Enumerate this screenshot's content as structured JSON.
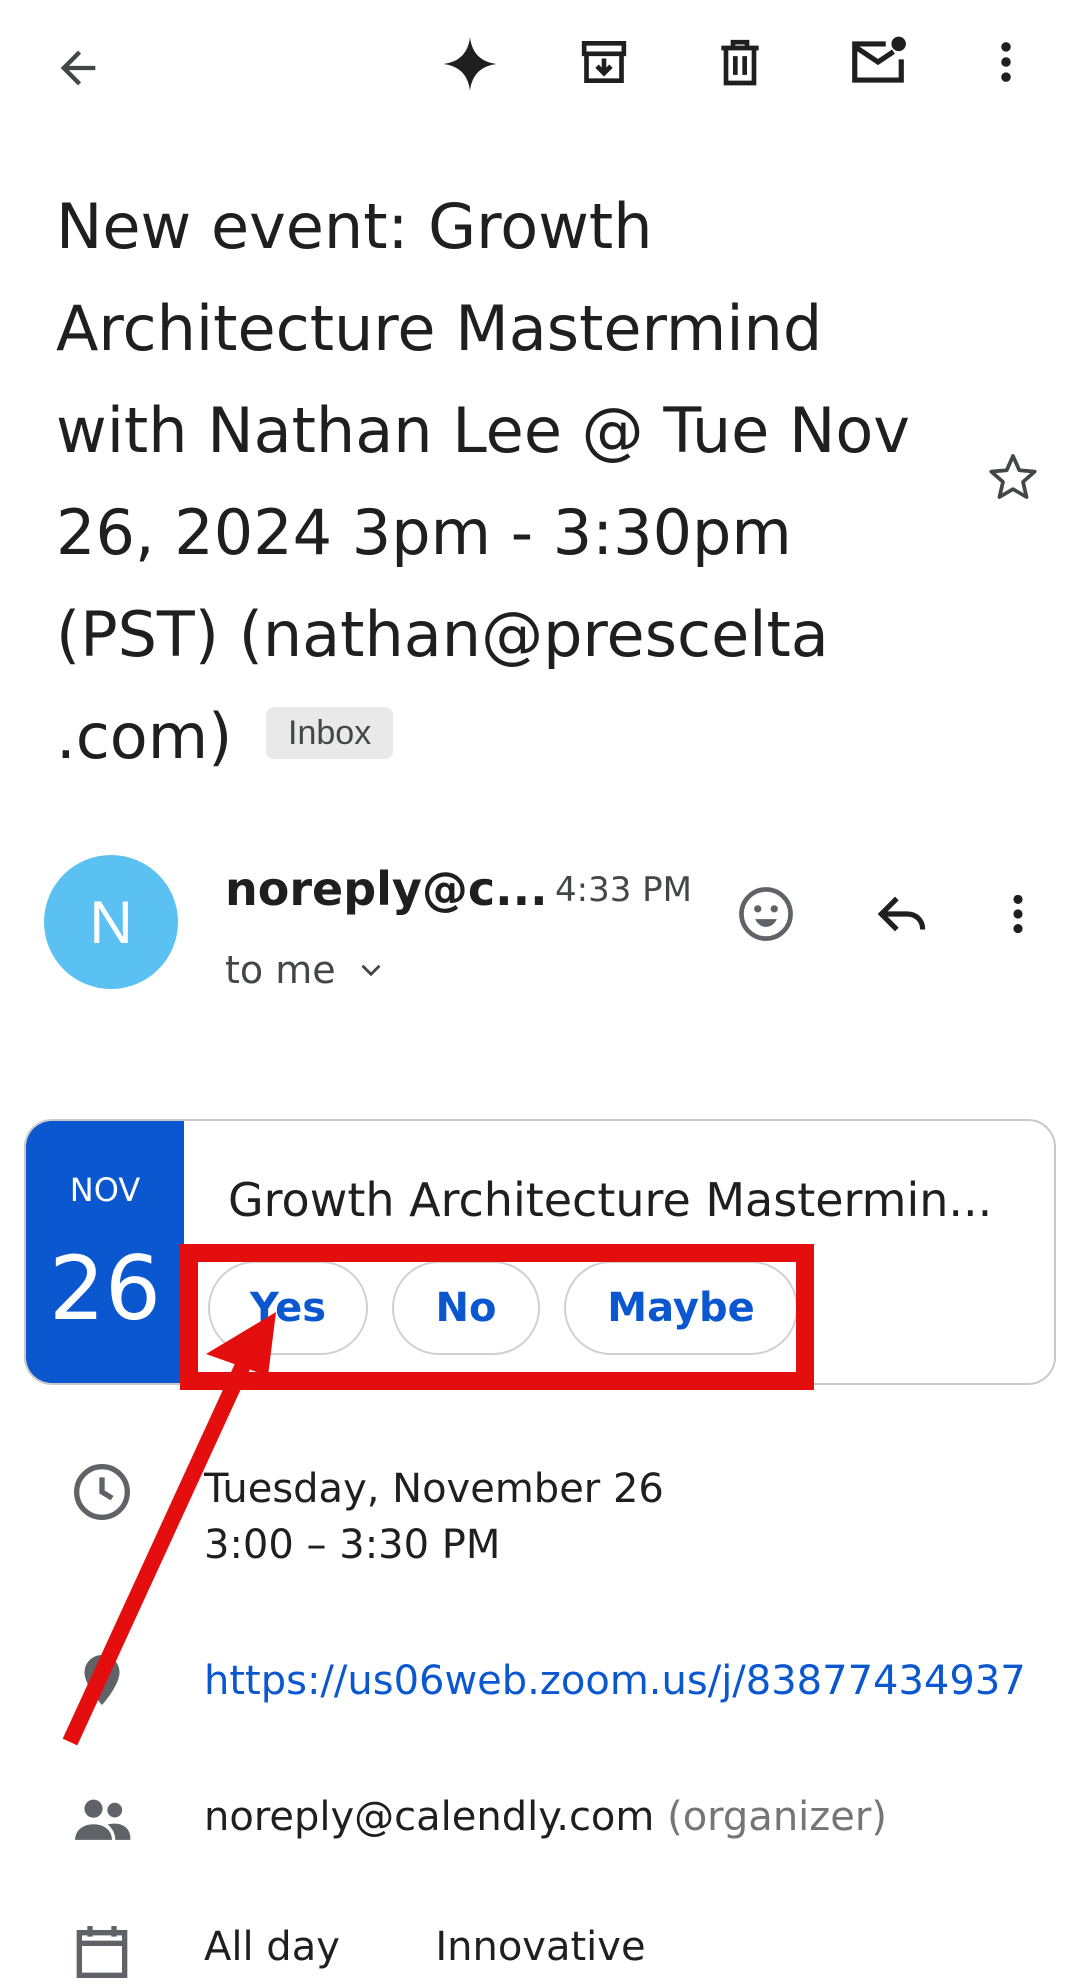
{
  "toolbar": {
    "back": "back",
    "gemini": "gemini-sparkle",
    "archive": "archive",
    "delete": "delete",
    "mark_unread": "mark-unread",
    "more": "more"
  },
  "subject": {
    "text": "New event: Growth Architecture Mastermind with Nathan Lee @ Tue Nov 26, 2024 3pm - 3:30pm (PST) (nathan@prescelta .com)",
    "label_chip": "Inbox"
  },
  "sender": {
    "avatar_letter": "N",
    "name": "noreply@c...",
    "time": "4:33 PM",
    "recipient": "to me"
  },
  "event": {
    "month": "NOV",
    "day": "26",
    "title": "Growth Architecture Mastermin...",
    "rsvp": {
      "yes": "Yes",
      "no": "No",
      "maybe": "Maybe"
    }
  },
  "details": {
    "date": "Tuesday, November 26",
    "time_range": "3:00 – 3:30 PM",
    "location_link": "https://us06web.zoom.us/j/83877434937",
    "organizer_email": "noreply@calendly.com",
    "organizer_role": "(organizer)",
    "calendar_left": "All day",
    "calendar_right": "Innovative"
  },
  "colors": {
    "accent": "#0b57d0",
    "avatar": "#5bc0f2",
    "annotation": "#e40e0e"
  }
}
